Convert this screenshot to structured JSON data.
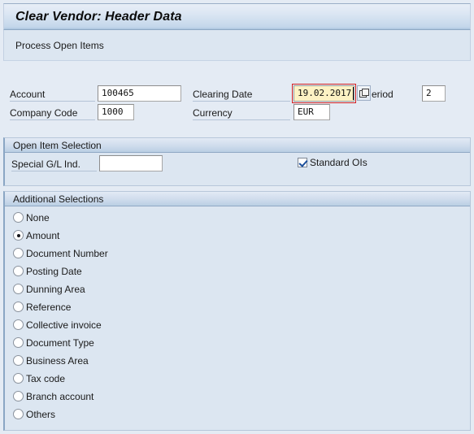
{
  "window": {
    "title": "Clear Vendor: Header Data",
    "subtitle": "Process Open Items"
  },
  "header_fields": {
    "account": {
      "label": "Account",
      "value": "100465"
    },
    "company_code": {
      "label": "Company Code",
      "value": "1000"
    },
    "clearing_date": {
      "label": "Clearing Date",
      "value": "19.02.2017",
      "focused": true
    },
    "currency": {
      "label": "Currency",
      "value": "EUR"
    },
    "period": {
      "label": "eriod",
      "value": "2"
    },
    "matchcode_icon": "matchcode-icon"
  },
  "open_item_selection": {
    "header": "Open Item Selection",
    "special_gl_ind": {
      "label": "Special G/L Ind.",
      "value": ""
    },
    "standard_ois": {
      "label": "Standard OIs",
      "checked": true
    }
  },
  "additional_selections": {
    "header": "Additional Selections",
    "selected": "Amount",
    "options": [
      {
        "label": "None",
        "selected": false
      },
      {
        "label": "Amount",
        "selected": true
      },
      {
        "label": "Document Number",
        "selected": false
      },
      {
        "label": "Posting Date",
        "selected": false
      },
      {
        "label": "Dunning Area",
        "selected": false
      },
      {
        "label": "Reference",
        "selected": false
      },
      {
        "label": "Collective invoice",
        "selected": false
      },
      {
        "label": "Document Type",
        "selected": false
      },
      {
        "label": "Business Area",
        "selected": false
      },
      {
        "label": "Tax code",
        "selected": false
      },
      {
        "label": "Branch account",
        "selected": false
      },
      {
        "label": "Others",
        "selected": false
      }
    ]
  },
  "colors": {
    "page_background": "#e4ebf4",
    "panel_background": "#dce6f1",
    "title_accent": "#a9c3de",
    "focus_border": "#d32020",
    "focus_field_background": "#fdf2c4",
    "group_left_accent": "#8aa6c4",
    "checkmark": "#1b4f9c"
  }
}
